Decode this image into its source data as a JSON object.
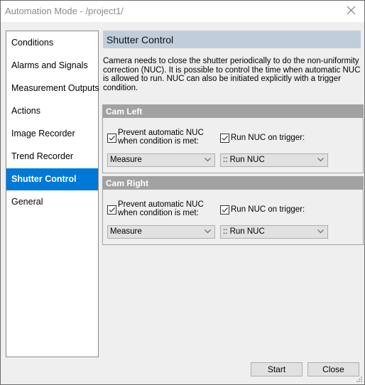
{
  "window": {
    "title": "Automation Mode - /project1/"
  },
  "sidebar": {
    "items": [
      {
        "label": "Conditions"
      },
      {
        "label": "Alarms and Signals"
      },
      {
        "label": "Measurement Outputs"
      },
      {
        "label": "Actions"
      },
      {
        "label": "Image Recorder"
      },
      {
        "label": "Trend Recorder"
      },
      {
        "label": "Shutter Control",
        "active": true
      },
      {
        "label": "General"
      }
    ]
  },
  "main": {
    "title": "Shutter Control",
    "description": "Camera needs to close the shutter periodically to do the non-uniformity correction (NUC). It is possible to control the time when automatic NUC is allowed to run. NUC can also be initiated explicitly with a trigger condition.",
    "groups": [
      {
        "title": "Cam Left",
        "prevent_label": "Prevent automatic NUC when condition is met:",
        "prevent_checked": true,
        "trigger_label": "Run NUC on trigger:",
        "trigger_checked": true,
        "condition_value": "Measure",
        "trigger_value": ":: Run NUC"
      },
      {
        "title": "Cam Right",
        "prevent_label": "Prevent automatic NUC when condition is met:",
        "prevent_checked": true,
        "trigger_label": "Run NUC on trigger:",
        "trigger_checked": true,
        "condition_value": "Measure",
        "trigger_value": ":: Run NUC"
      }
    ]
  },
  "footer": {
    "start_label": "Start",
    "close_label": "Close"
  },
  "colors": {
    "accent": "#0078d7",
    "header_band": "#c0cedc",
    "group_header": "#a2a2a2"
  }
}
